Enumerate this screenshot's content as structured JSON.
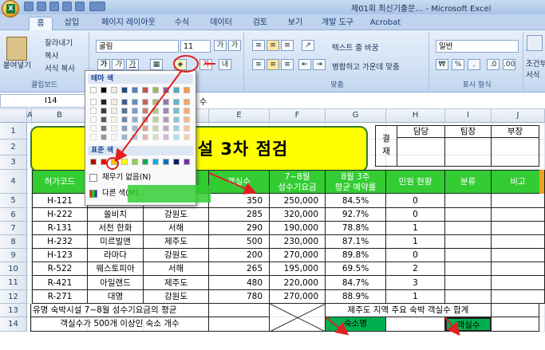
{
  "window": {
    "title": "제01회 최신기출문…   -  Microsoft Excel"
  },
  "tabs": [
    "홈",
    "삽입",
    "페이지 레이아웃",
    "수식",
    "데이터",
    "검토",
    "보기",
    "개발 도구",
    "Acrobat"
  ],
  "ribbon": {
    "clipboard": {
      "paste": "붙여넣기",
      "cut": "잘라내기",
      "copy": "복사",
      "format_painter": "서식 복사",
      "label": "클립보드"
    },
    "font": {
      "name": "굴림",
      "size": "11",
      "grow": "가",
      "shrink": "가",
      "bold": "가",
      "italic": "가",
      "underline": "가",
      "label": "글꼴"
    },
    "alignment": {
      "wrap_text": "텍스트 줄 바꿈",
      "merge": "병합하고 가운데 맞춤",
      "label": "맞춤"
    },
    "number": {
      "format": "일반",
      "percent": "%",
      "comma": ",",
      "label": "표시 형식"
    },
    "styles": {
      "conditional": "조건부",
      "conditional2": "서식"
    }
  },
  "formula_bar": {
    "name_box": "I14",
    "value": "수"
  },
  "color_popup": {
    "theme_label": "테마 색",
    "standard_label": "표준 색",
    "no_fill": "채우기 없음(N)",
    "more_colors": "다른 색(M)...",
    "theme_colors": [
      "#ffffff",
      "#000000",
      "#eeece1",
      "#1f497d",
      "#4f81bd",
      "#c0504d",
      "#9bbb59",
      "#8064a2",
      "#4bacc6",
      "#f79646"
    ],
    "standard_colors": [
      "#c00000",
      "#ff0000",
      "#ffc000",
      "#ffff00",
      "#92d050",
      "#00b050",
      "#00b0f0",
      "#0070c0",
      "#002060",
      "#7030a0"
    ]
  },
  "columns": [
    "A",
    "B",
    "C",
    "D",
    "E",
    "F",
    "G",
    "H",
    "I",
    "J"
  ],
  "rows": [
    "1",
    "2",
    "3",
    "4",
    "5",
    "6",
    "7",
    "8",
    "9",
    "10",
    "11",
    "12",
    "13",
    "14"
  ],
  "sheet": {
    "title": "유명 숙박시설 3차 점검",
    "approval": {
      "label": "결\n재",
      "roles": [
        "담당",
        "팀장",
        "부장"
      ]
    },
    "headers": [
      "허가코드",
      "숙박시설명",
      "지역",
      "객실수",
      "7~8월\n성수기요금",
      "8월 3주\n평균 예약률",
      "민원 현황",
      "분류",
      "비고"
    ],
    "data": [
      [
        "H-121",
        "루스톤앤",
        "제주도",
        "350",
        "250,000",
        "84.5%",
        "0"
      ],
      [
        "H-222",
        "쏠비치",
        "강원도",
        "285",
        "320,000",
        "92.7%",
        "0"
      ],
      [
        "R-131",
        "서천 한화",
        "서해",
        "290",
        "190,000",
        "78.8%",
        "1"
      ],
      [
        "H-232",
        "미르빌앤",
        "제주도",
        "500",
        "230,000",
        "87.1%",
        "1"
      ],
      [
        "H-123",
        "라마다",
        "강원도",
        "200",
        "270,000",
        "89.8%",
        "0"
      ],
      [
        "R-522",
        "웨스토피아",
        "서해",
        "265",
        "195,000",
        "69.5%",
        "2"
      ],
      [
        "R-421",
        "아일랜드",
        "제주도",
        "480",
        "220,000",
        "84.7%",
        "3"
      ],
      [
        "R-271",
        "대명",
        "강원도",
        "780",
        "270,000",
        "88.9%",
        "1"
      ]
    ],
    "row13_left": "유명 숙박시설 7~8월 성수기요금의 평균",
    "row13_right": "제주도 지역 주요 숙박 객실수 합계",
    "row14_left": "객실수가 500개 이상인 숙소 개수",
    "row14_g": "숙소명",
    "row14_i": "객실수"
  },
  "colors": {
    "header_green": "#33cc33",
    "title_yellow": "#ffff00",
    "arrow_red": "#e02020"
  }
}
